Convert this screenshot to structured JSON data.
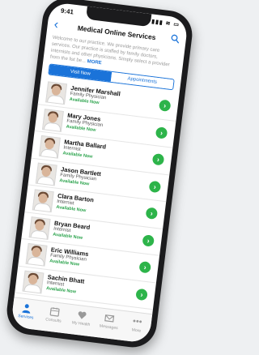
{
  "status_bar": {
    "time": "9:41",
    "icons": "▮▮▮ ≋ ▭"
  },
  "nav": {
    "title": "Medical Online Services",
    "back_icon": "chevron-left-icon",
    "search_icon": "search-icon"
  },
  "intro": {
    "text": "Welcome to our practice. We provide primary care services. Our practice is staffed by family doctors, internists and other physicians. Simply select a provider from the list be...",
    "more": "MORE"
  },
  "segments": [
    {
      "label": "Visit Now",
      "active": true
    },
    {
      "label": "Appointments",
      "active": false
    }
  ],
  "providers": [
    {
      "name": "Jennifer Marshall",
      "specialty": "Family Physician",
      "availability": "Available Now"
    },
    {
      "name": "Mary Jones",
      "specialty": "Family Physician",
      "availability": "Available Now"
    },
    {
      "name": "Martha Ballard",
      "specialty": "Internist",
      "availability": "Available Now"
    },
    {
      "name": "Jason Bartlett",
      "specialty": "Family Physician",
      "availability": "Available Now"
    },
    {
      "name": "Clara Barton",
      "specialty": "Internist",
      "availability": "Available Now"
    },
    {
      "name": "Bryan Beard",
      "specialty": "Internist",
      "availability": "Available Now"
    },
    {
      "name": "Eric Williams",
      "specialty": "Family Physician",
      "availability": "Available Now"
    },
    {
      "name": "Sachin Bhatt",
      "specialty": "Internist",
      "availability": "Available Now"
    }
  ],
  "tabs": [
    {
      "label": "Services",
      "icon": "person-icon",
      "active": true
    },
    {
      "label": "Consults",
      "icon": "calendar-icon",
      "active": false
    },
    {
      "label": "My Health",
      "icon": "heart-icon",
      "active": false
    },
    {
      "label": "Messages",
      "icon": "envelope-icon",
      "active": false
    },
    {
      "label": "More",
      "icon": "more-icon",
      "active": false
    }
  ],
  "colors": {
    "accent": "#1a73d9",
    "available": "#2da44e",
    "go_button": "#2db44a"
  }
}
